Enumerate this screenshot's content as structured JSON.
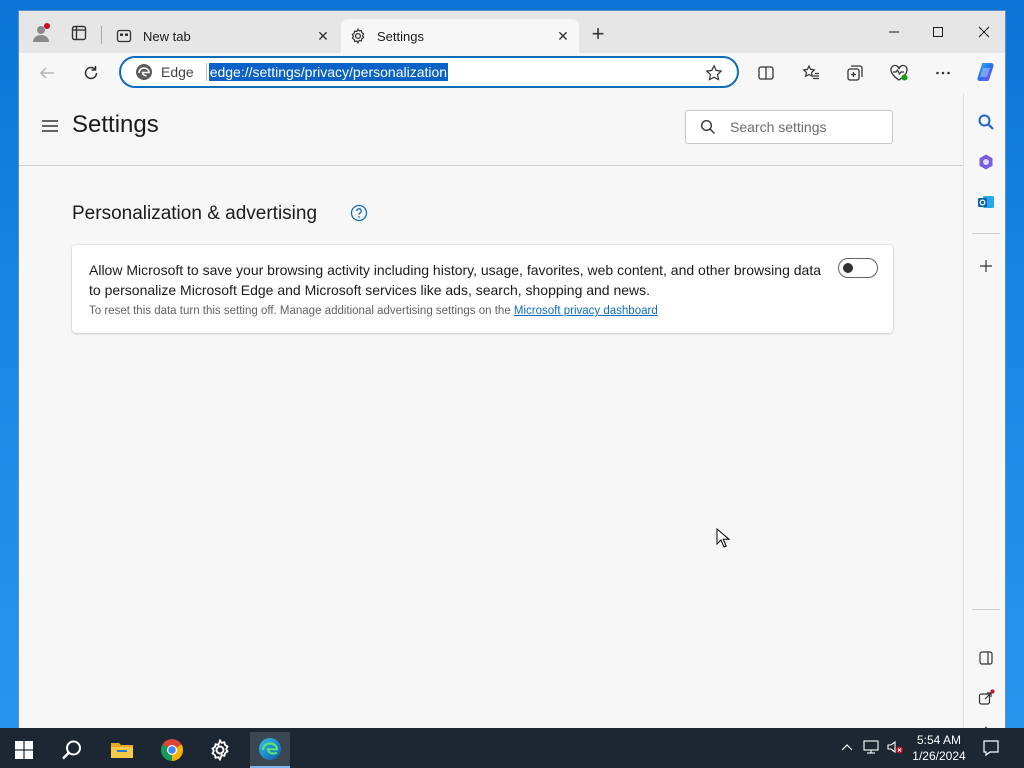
{
  "browser": {
    "tabs": [
      {
        "title": "New tab",
        "active": false
      },
      {
        "title": "Settings",
        "active": true
      }
    ],
    "address_bar": {
      "site_label": "Edge",
      "url": "edge://settings/privacy/personalization"
    }
  },
  "settings": {
    "page_title": "Settings",
    "search": {
      "placeholder": "Search settings",
      "value": ""
    },
    "section": {
      "title": "Personalization & advertising",
      "card": {
        "description": "Allow Microsoft to save your browsing activity including history, usage, favorites, web content, and other browsing data to personalize Microsoft Edge and Microsoft services like ads, search, shopping and news.",
        "subtext_prefix": "To reset this data turn this setting off. Manage additional advertising settings on the ",
        "subtext_link": "Microsoft privacy dashboard",
        "toggle_on": false
      }
    }
  },
  "taskbar": {
    "time": "5:54 AM",
    "date": "1/26/2024"
  },
  "colors": {
    "accent": "#0f6cbd",
    "url_selection": "#0b62c6",
    "desktop": "#1a8ae6",
    "taskbar": "#1c2733"
  }
}
